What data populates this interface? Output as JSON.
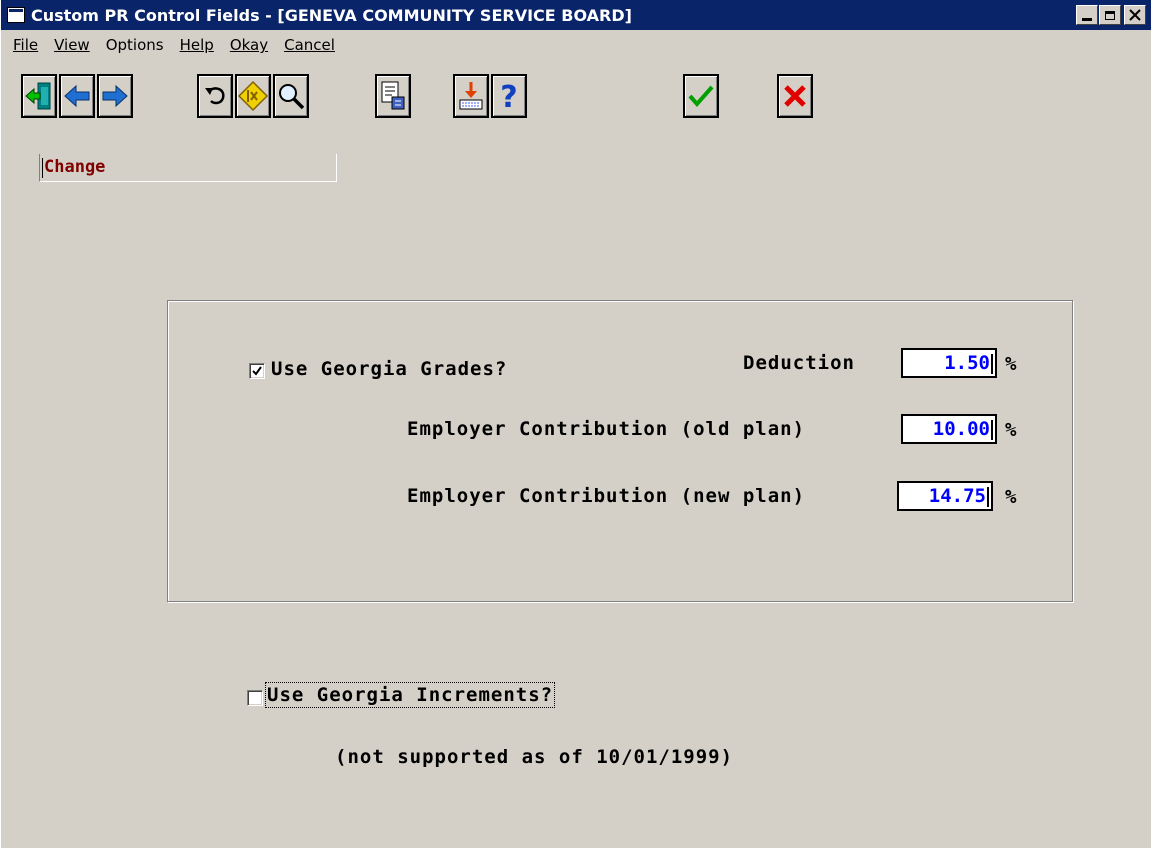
{
  "window": {
    "title": "Custom PR Control Fields - [GENEVA COMMUNITY SERVICE BOARD]"
  },
  "menu": [
    {
      "label": "File",
      "mnemonic": "F"
    },
    {
      "label": "View",
      "mnemonic": "V"
    },
    {
      "label": "Options",
      "mnemonic": ""
    },
    {
      "label": "Help",
      "mnemonic": "H"
    },
    {
      "label": "Okay",
      "mnemonic": "O"
    },
    {
      "label": "Cancel",
      "mnemonic": "C"
    }
  ],
  "toolbar": {
    "buttons": [
      {
        "name": "exit-icon"
      },
      {
        "name": "arrow-left-icon"
      },
      {
        "name": "arrow-right-icon"
      },
      {
        "name": "undo-icon"
      },
      {
        "name": "diamond-icon"
      },
      {
        "name": "magnifier-icon"
      },
      {
        "name": "document-icon"
      },
      {
        "name": "import-icon"
      },
      {
        "name": "help-question-icon"
      },
      {
        "name": "checkmark-icon"
      },
      {
        "name": "cancel-x-icon"
      }
    ]
  },
  "mode": "Change",
  "form": {
    "use_grades_label": "Use Georgia Grades?",
    "use_grades_checked": true,
    "deduction_label": "Deduction",
    "deduction_value": "1.50",
    "old_plan_label": "Employer Contribution (old plan)",
    "old_plan_value": "10.00",
    "new_plan_label": "Employer Contribution (new plan)",
    "new_plan_value": "14.75",
    "percent_symbol": "%",
    "use_increments_label": "Use Georgia Increments?",
    "use_increments_checked": false,
    "not_supported_note": "(not supported as of 10/01/1999)"
  },
  "colors": {
    "titlebar": "#0a246a",
    "window_bg": "#d4d0c8",
    "mode_text": "#800000",
    "value_text": "#0000ff"
  }
}
